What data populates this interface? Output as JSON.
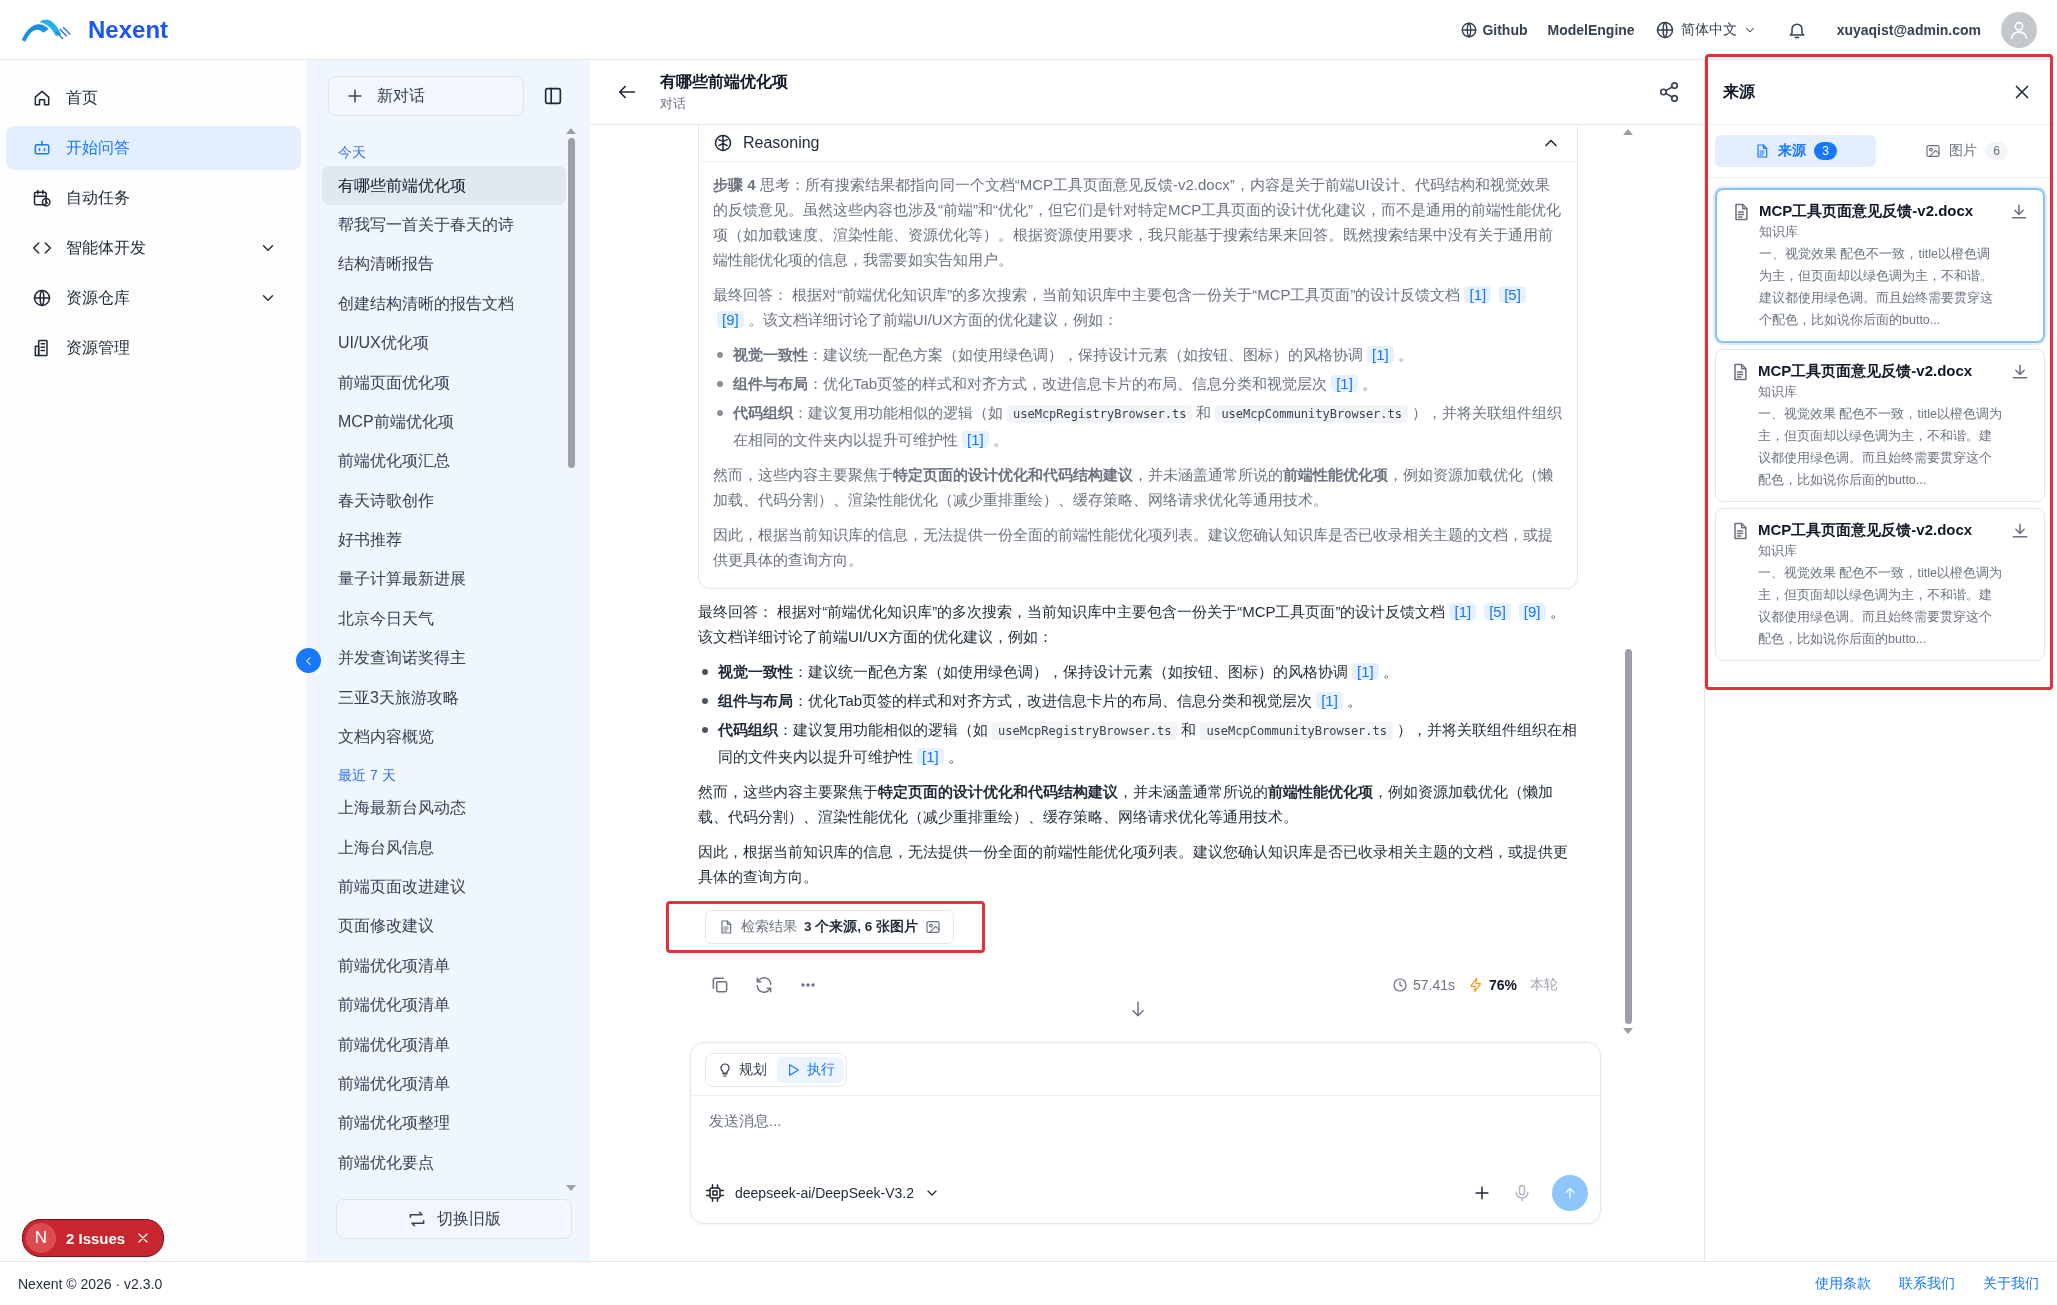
{
  "header": {
    "brand": "Nexent",
    "links": [
      {
        "label": "Github"
      },
      {
        "label": "ModelEngine"
      }
    ],
    "language": "简体中文",
    "user": "xuyaqist@admin.com"
  },
  "nav": {
    "items": [
      {
        "label": "首页",
        "kind": "link",
        "selected": false
      },
      {
        "label": "开始问答",
        "kind": "link",
        "selected": true
      },
      {
        "label": "自动任务",
        "kind": "link",
        "selected": false
      },
      {
        "label": "智能体开发",
        "kind": "group",
        "selected": false,
        "expanded": false
      },
      {
        "label": "资源仓库",
        "kind": "group",
        "selected": false,
        "expanded": false
      },
      {
        "label": "资源管理",
        "kind": "link",
        "selected": false
      }
    ]
  },
  "conversations": {
    "new_button": "新对话",
    "groups": [
      {
        "title": "今天",
        "items": [
          {
            "label": "有哪些前端优化项",
            "selected": true
          },
          {
            "label": "帮我写一首关于春天的诗",
            "selected": false
          },
          {
            "label": "结构清晰报告",
            "selected": false
          },
          {
            "label": "创建结构清晰的报告文档",
            "selected": false
          },
          {
            "label": "UI/UX优化项",
            "selected": false
          },
          {
            "label": "前端页面优化项",
            "selected": false
          },
          {
            "label": "MCP前端优化项",
            "selected": false
          },
          {
            "label": "前端优化项汇总",
            "selected": false
          },
          {
            "label": "春天诗歌创作",
            "selected": false
          },
          {
            "label": "好书推荐",
            "selected": false
          },
          {
            "label": "量子计算最新进展",
            "selected": false
          },
          {
            "label": "北京今日天气",
            "selected": false
          },
          {
            "label": "并发查询诺奖得主",
            "selected": false
          },
          {
            "label": "三亚3天旅游攻略",
            "selected": false
          },
          {
            "label": "文档内容概览",
            "selected": false
          }
        ]
      },
      {
        "title": "最近 7 天",
        "items": [
          {
            "label": "上海最新台风动态",
            "selected": false
          },
          {
            "label": "上海台风信息",
            "selected": false
          },
          {
            "label": "前端页面改进建议",
            "selected": false
          },
          {
            "label": "页面修改建议",
            "selected": false
          },
          {
            "label": "前端优化项清单",
            "selected": false
          },
          {
            "label": "前端优化项清单",
            "selected": false
          },
          {
            "label": "前端优化项清单",
            "selected": false
          },
          {
            "label": "前端优化项清单",
            "selected": false
          },
          {
            "label": "前端优化项整理",
            "selected": false
          },
          {
            "label": "前端优化要点",
            "selected": false
          }
        ]
      }
    ],
    "switch_button": "切换旧版"
  },
  "chat": {
    "title": "有哪些前端优化项",
    "subtitle": "对话",
    "reasoning": {
      "title": "Reasoning",
      "expanded": true,
      "blocks": [
        {
          "kind": "para",
          "segments": [
            {
              "kind": "text",
              "text": "**步骤 4** 思考：所有搜索结果都指向同一个文档“MCP工具页面意见反馈-v2.docx”，内容是关于前端UI设计、代码结构和视觉效果的反馈意见。虽然这些内容也涉及“前端”和“优化”，但它们是针对特定MCP工具页面的设计优化建议，而不是通用的前端性能优化项（如加载速度、渲染性能、资源优化等）。根据资源使用要求，我只能基于搜索结果来回答。既然搜索结果中没有关于通用前端性能优化项的信息，我需要如实告知用户。"
            }
          ]
        },
        {
          "kind": "para",
          "segments": [
            {
              "kind": "text",
              "text": "最终回答： 根据对“前端优化知识库”的多次搜索，当前知识库中主要包含一份关于“MCP工具页面”的设计反馈文档"
            },
            {
              "kind": "cite",
              "text": "[1]"
            },
            {
              "kind": "cite",
              "text": "[5]"
            },
            {
              "kind": "cite",
              "text": "[9]"
            },
            {
              "kind": "text",
              "text": "。该文档详细讨论了前端UI/UX方面的优化建议，例如："
            }
          ]
        },
        {
          "kind": "bullet",
          "segments": [
            {
              "kind": "text",
              "text": "**视觉一致性**：建议统一配色方案（如使用绿色调），保持设计元素（如按钮、图标）的风格协调"
            },
            {
              "kind": "cite",
              "text": "[1]"
            },
            {
              "kind": "text",
              "text": "。"
            }
          ]
        },
        {
          "kind": "bullet",
          "segments": [
            {
              "kind": "text",
              "text": "**组件与布局**：优化Tab页签的样式和对齐方式，改进信息卡片的布局、信息分类和视觉层次"
            },
            {
              "kind": "cite",
              "text": "[1]"
            },
            {
              "kind": "text",
              "text": "。"
            }
          ]
        },
        {
          "kind": "bullet",
          "segments": [
            {
              "kind": "text",
              "text": "**代码组织**：建议复用功能相似的逻辑（如"
            },
            {
              "kind": "code",
              "text": "useMcpRegistryBrowser.ts"
            },
            {
              "kind": "text",
              "text": "和"
            },
            {
              "kind": "code",
              "text": "useMcpCommunityBrowser.ts"
            },
            {
              "kind": "text",
              "text": "），并将关联组件组织在相同的文件夹内以提升可维护性"
            },
            {
              "kind": "cite",
              "text": "[1]"
            },
            {
              "kind": "text",
              "text": "。"
            }
          ]
        },
        {
          "kind": "para",
          "segments": [
            {
              "kind": "text",
              "text": "然而，这些内容主要聚焦于**特定页面的设计优化和代码结构建议**，并未涵盖通常所说的**前端性能优化项**，例如资源加载优化（懒加载、代码分割）、渲染性能优化（减少重排重绘）、缓存策略、网络请求优化等通用技术。"
            }
          ]
        },
        {
          "kind": "para",
          "segments": [
            {
              "kind": "text",
              "text": "因此，根据当前知识库的信息，无法提供一份全面的前端性能优化项列表。建议您确认知识库是否已收录相关主题的文档，或提供更具体的查询方向。"
            }
          ]
        }
      ]
    },
    "answer": {
      "blocks": [
        {
          "kind": "para",
          "segments": [
            {
              "kind": "text",
              "text": "最终回答： 根据对“前端优化知识库”的多次搜索，当前知识库中主要包含一份关于“MCP工具页面”的设计反馈文档"
            },
            {
              "kind": "cite",
              "text": "[1]"
            },
            {
              "kind": "cite",
              "text": "[5]"
            },
            {
              "kind": "cite",
              "text": "[9]"
            },
            {
              "kind": "text",
              "text": "。该文档详细讨论了前端UI/UX方面的优化建议，例如："
            }
          ]
        },
        {
          "kind": "bullet",
          "segments": [
            {
              "kind": "text",
              "text": "**视觉一致性**：建议统一配色方案（如使用绿色调），保持设计元素（如按钮、图标）的风格协调"
            },
            {
              "kind": "cite",
              "text": "[1]"
            },
            {
              "kind": "text",
              "text": "。"
            }
          ]
        },
        {
          "kind": "bullet",
          "segments": [
            {
              "kind": "text",
              "text": "**组件与布局**：优化Tab页签的样式和对齐方式，改进信息卡片的布局、信息分类和视觉层次"
            },
            {
              "kind": "cite",
              "text": "[1]"
            },
            {
              "kind": "text",
              "text": "。"
            }
          ]
        },
        {
          "kind": "bullet",
          "segments": [
            {
              "kind": "text",
              "text": "**代码组织**：建议复用功能相似的逻辑（如"
            },
            {
              "kind": "code",
              "text": "useMcpRegistryBrowser.ts"
            },
            {
              "kind": "text",
              "text": "和"
            },
            {
              "kind": "code",
              "text": "useMcpCommunityBrowser.ts"
            },
            {
              "kind": "text",
              "text": "），并将关联组件组织在相同的文件夹内以提升可维护性"
            },
            {
              "kind": "cite",
              "text": "[1]"
            },
            {
              "kind": "text",
              "text": "。"
            }
          ]
        },
        {
          "kind": "para",
          "segments": [
            {
              "kind": "text",
              "text": "然而，这些内容主要聚焦于**特定页面的设计优化和代码结构建议**，并未涵盖通常所说的**前端性能优化项**，例如资源加载优化（懒加载、代码分割）、渲染性能优化（减少重排重绘）、缓存策略、网络请求优化等通用技术。"
            }
          ]
        },
        {
          "kind": "para",
          "segments": [
            {
              "kind": "text",
              "text": "因此，根据当前知识库的信息，无法提供一份全面的前端性能优化项列表。建议您确认知识库是否已收录相关主题的文档，或提供更具体的查询方向。"
            }
          ]
        }
      ]
    },
    "search_result": {
      "label": "检索结果",
      "summary": "3 个来源, 6 张图片",
      "highlighted": true
    },
    "stats": {
      "duration": "57.41s",
      "ratio": "76%",
      "ratio_label": "本轮"
    },
    "composer": {
      "modes": [
        {
          "label": "规划",
          "selected": false
        },
        {
          "label": "执行",
          "selected": true
        }
      ],
      "placeholder": "发送消息...",
      "model": "deepseek-ai/DeepSeek-V3.2"
    }
  },
  "sources_panel": {
    "title": "来源",
    "highlighted": true,
    "tabs": [
      {
        "label": "来源",
        "count": "3",
        "selected": true
      },
      {
        "label": "图片",
        "count": "6",
        "selected": false
      }
    ],
    "cards": [
      {
        "title": "MCP工具页面意见反馈-v2.docx",
        "source": "知识库",
        "snippet": "一、视觉效果 配色不一致，title以橙色调为主，但页面却以绿色调为主，不和谐。建议都使用绿色调。而且始终需要贯穿这个配色，比如说你后面的butto...",
        "selected": true
      },
      {
        "title": "MCP工具页面意见反馈-v2.docx",
        "source": "知识库",
        "snippet": "一、视觉效果 配色不一致，title以橙色调为主，但页面却以绿色调为主，不和谐。建议都使用绿色调。而且始终需要贯穿这个配色，比如说你后面的butto...",
        "selected": false
      },
      {
        "title": "MCP工具页面意见反馈-v2.docx",
        "source": "知识库",
        "snippet": "一、视觉效果 配色不一致，title以橙色调为主，但页面却以绿色调为主，不和谐。建议都使用绿色调。而且始终需要贯穿这个配色，比如说你后面的butto...",
        "selected": false
      }
    ]
  },
  "footer": {
    "copyright": "Nexent © 2026 · v2.3.0",
    "links": [
      {
        "label": "使用条款"
      },
      {
        "label": "联系我们"
      },
      {
        "label": "关于我们"
      }
    ]
  },
  "issues_badge": {
    "letter": "N",
    "label": "2 Issues"
  }
}
